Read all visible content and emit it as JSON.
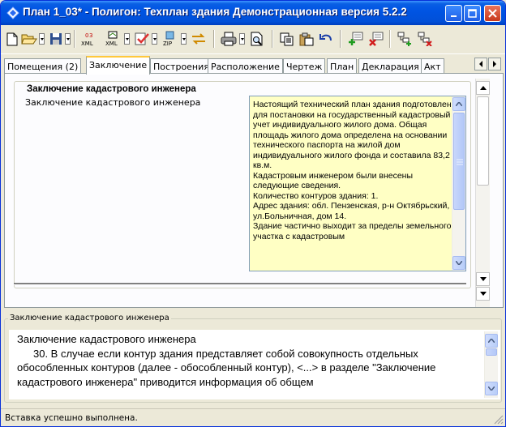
{
  "window": {
    "title": "План 1_03* - Полигон: Техплан здания Демонстрационная версия 5.2.2"
  },
  "toolbar": {
    "buttons": [
      {
        "name": "new-document-icon"
      },
      {
        "name": "open-folder-icon"
      },
      {
        "name": "save-icon"
      },
      {
        "name": "xml-export-icon",
        "text": "XML"
      },
      {
        "name": "xml-import-icon",
        "text": "XML"
      },
      {
        "name": "check-icon"
      },
      {
        "name": "zip-icon",
        "text": "ZIP"
      },
      {
        "name": "transfer-icon"
      },
      {
        "name": "print-icon"
      },
      {
        "name": "print-preview-icon"
      },
      {
        "name": "copy-icon"
      },
      {
        "name": "paste-icon"
      },
      {
        "name": "undo-icon"
      },
      {
        "name": "add-row-icon"
      },
      {
        "name": "delete-row-icon"
      },
      {
        "name": "add-tree-icon"
      },
      {
        "name": "delete-tree-icon"
      }
    ]
  },
  "tabs": [
    {
      "label": "Помещения (2)"
    },
    {
      "label": "Заключение",
      "active": true
    },
    {
      "label": "Построения"
    },
    {
      "label": "Расположение"
    },
    {
      "label": "Чертеж"
    },
    {
      "label": "План"
    },
    {
      "label": "Декларация"
    },
    {
      "label": "Акт"
    }
  ],
  "panel": {
    "group_title": "Заключение кадастрового инженера",
    "field_label": "Заключение кадастрового инженера",
    "memo_text": "Настоящий технический план здания подготовлен для постановки на государственный кадастровый учет индивидуального жилого дома. Общая площадь жилого дома определена на основании технического паспорта на жилой дом индивидуального жилого фонда и составила 83,2 кв.м.\nКадастровым инженером были внесены следующие сведения.\nКоличество контуров здания: 1.\nАдрес здания: обл. Пензенская, р-н Октябрьский, ул.Больничная, дом 14.\nЗдание частично выходит за пределы земельного участка с кадастровым"
  },
  "help": {
    "group_title": "Заключение кадастрового инженера",
    "heading": "Заключение кадастрового инженера",
    "body": "30. В случае если контур здания представляет собой совокупность отдельных обособленных контуров (далее - обособленный контур), <...> в разделе \"Заключение кадастрового инженера\" приводится информация об общем"
  },
  "status": {
    "text": "Вставка успешно выполнена."
  },
  "colors": {
    "titlebar": "#0054e3",
    "memo_bg": "#ffffc4",
    "active_tab_accent": "#ffc83c"
  }
}
